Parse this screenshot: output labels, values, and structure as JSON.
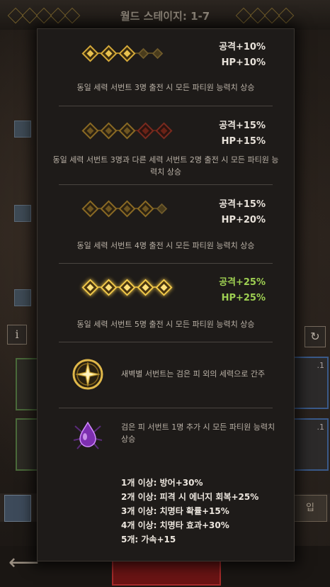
{
  "background": {
    "stage_title": "월드 스테이지: 1-7",
    "info_label": "i",
    "refresh_label": "↻",
    "right_button_label": "입",
    "card_right_labels": [
      ".1",
      ".1"
    ]
  },
  "colors": {
    "gold": "#c9a23a",
    "gold_bright": "#e7c04b",
    "dim_gold": "#6e5a2a",
    "red_dim": "#7a2a1e",
    "highlight_green": "#9ecf52"
  },
  "tiers": [
    {
      "states": [
        "active",
        "active",
        "active",
        "inactive",
        "inactive"
      ],
      "attack": "공격+10%",
      "hp": "HP+10%",
      "highlight": false,
      "description": "동일 세력 서번트 3명 출전 시 모든 파티원 능력치 상승"
    },
    {
      "states": [
        "dim",
        "dim",
        "dim",
        "red",
        "red"
      ],
      "attack": "공격+15%",
      "hp": "HP+15%",
      "highlight": false,
      "description": "동일 세력 서번트 3명과 다른 세력 서번트 2명 출전 시 모든 파티원 능력치 상승"
    },
    {
      "states": [
        "dim",
        "dim",
        "dim",
        "dim",
        "inactive"
      ],
      "attack": "공격+15%",
      "hp": "HP+20%",
      "highlight": false,
      "description": "동일 세력 서번트 4명 출전 시 모든 파티원 능력치 상승"
    },
    {
      "states": [
        "bright",
        "bright",
        "bright",
        "bright",
        "bright"
      ],
      "attack": "공격+25%",
      "hp": "HP+25%",
      "highlight": true,
      "description": "동일 세력 서번트 5명 출전 시 모든 파티원 능력치 상승"
    }
  ],
  "special": {
    "dawn_icon": "compass-star-icon",
    "dawn_text": "새벽별 서번트는 검은 피 외의 세력으로 간주",
    "blood_icon": "dark-blood-drop-icon",
    "blood_text": "검은 피 서번트 1명 추가 시 모든 파티원 능력치 상승",
    "blood_bonuses": [
      "1개 이상: 방어+30%",
      "2개 이상: 피격 시 에너지 회복+25%",
      "3개 이상: 치명타 확률+15%",
      "4개 이상: 치명타 효과+30%",
      "5개: 가속+15"
    ]
  }
}
